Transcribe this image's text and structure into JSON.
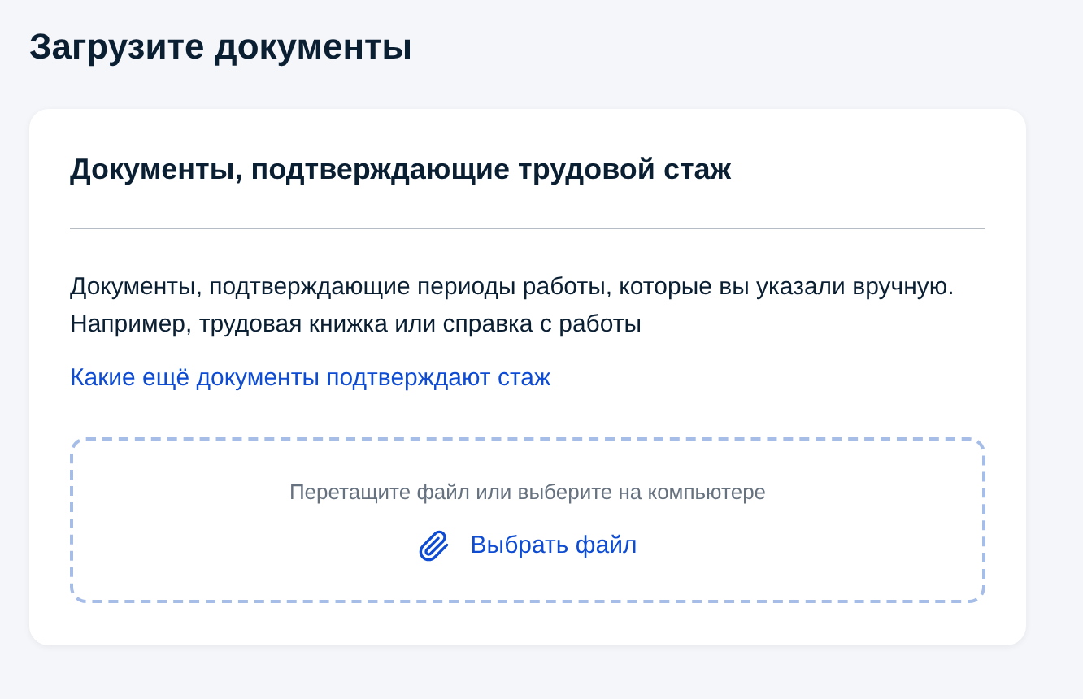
{
  "page_title": "Загрузите документы",
  "card": {
    "title": "Документы, подтверждающие трудовой стаж",
    "description": "Документы, подтверждающие периоды работы, которые вы указали вручную. Например, трудовая книжка или справка с работы",
    "link": "Какие ещё документы подтверждают стаж",
    "dropzone": {
      "hint": "Перетащите файл или выберите на компьютере",
      "button": "Выбрать файл"
    }
  }
}
